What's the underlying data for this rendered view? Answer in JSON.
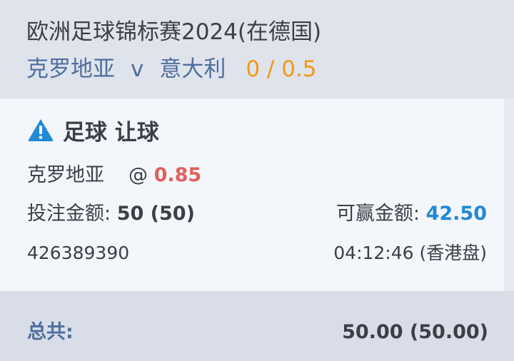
{
  "header": {
    "league": "欧洲足球锦标赛2024(在德国)",
    "home_team": "克罗地亚",
    "vs": "v",
    "away_team": "意大利",
    "handicap": "0 / 0.5"
  },
  "bet": {
    "icon": "warning-triangle-icon",
    "type": "足球 让球",
    "selection": "克罗地亚",
    "at_symbol": "@",
    "odds": "0.85",
    "stake_label": "投注金额:",
    "stake_value": "50 (50)",
    "win_label": "可赢金额:",
    "win_value": "42.50",
    "ticket_id": "426389390",
    "time_and_odds_type": "04:12:46 (香港盘)"
  },
  "total": {
    "label": "总共:",
    "value": "50.00 (50.00)"
  },
  "colors": {
    "accent_blue": "#2189d6",
    "team_blue": "#4e6e9d",
    "handicap_orange": "#f09a16",
    "odds_red": "#e0605c"
  }
}
